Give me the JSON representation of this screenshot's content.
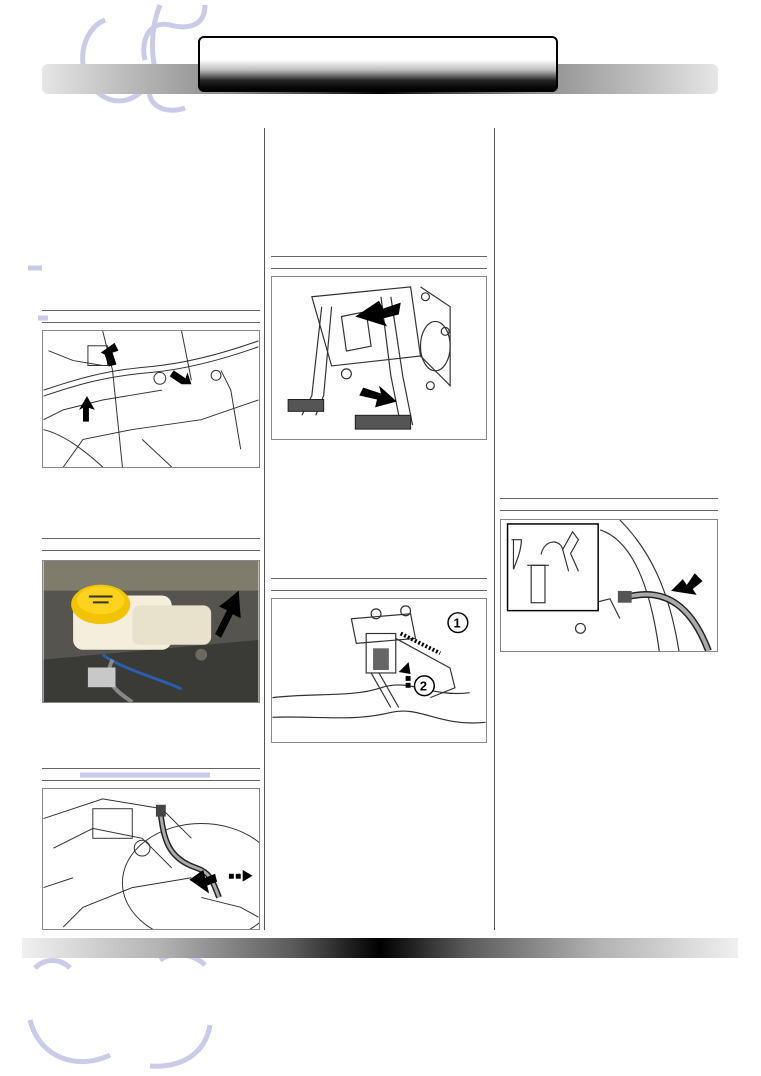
{
  "header": {
    "title": ""
  },
  "figures": [
    {
      "name": "figure-fuel-lines",
      "callouts": []
    },
    {
      "name": "figure-brake-fluid-reservoir",
      "callouts": []
    },
    {
      "name": "figure-brake-booster-hose",
      "callouts": []
    },
    {
      "name": "figure-pedal-assembly",
      "callouts": []
    },
    {
      "name": "figure-clutch-master-cylinder",
      "callouts": [
        "1",
        "2"
      ]
    },
    {
      "name": "figure-clutch-hose-tool",
      "callouts": []
    }
  ],
  "colors": {
    "reservoir_cap": "#f2c400",
    "reservoir_body": "#f4efdc",
    "engine_bay": "#55544e",
    "arrow": "#000000"
  }
}
